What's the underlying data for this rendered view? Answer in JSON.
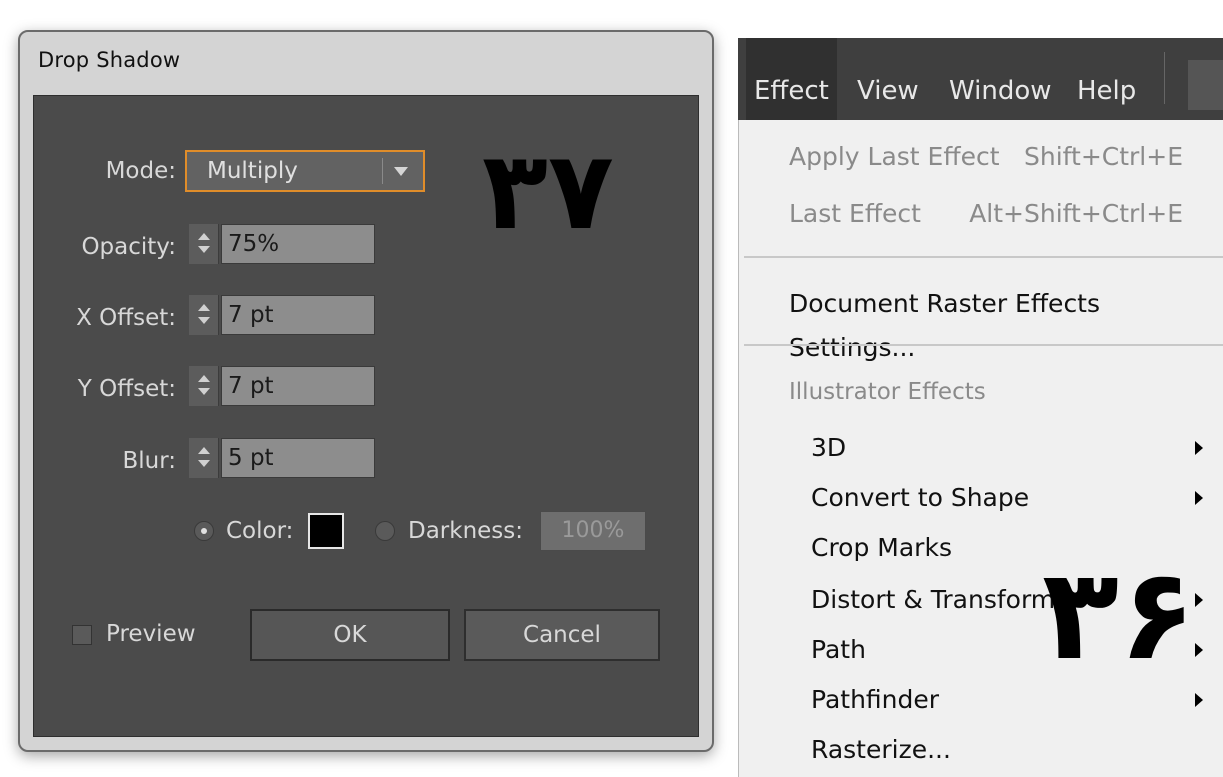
{
  "dialog": {
    "title": "Drop Shadow",
    "mode": {
      "label": "Mode:",
      "value": "Multiply"
    },
    "opacity": {
      "label": "Opacity:",
      "value": "75%"
    },
    "x_offset": {
      "label": "X Offset:",
      "value": "7 pt"
    },
    "y_offset": {
      "label": "Y Offset:",
      "value": "7 pt"
    },
    "blur": {
      "label": "Blur:",
      "value": "5 pt"
    },
    "color_option": {
      "label": "Color:",
      "selected": true,
      "swatch_color": "#000000"
    },
    "darkness_option": {
      "label": "Darkness:",
      "value": "100%",
      "selected": false
    },
    "preview": {
      "label": "Preview",
      "checked": false
    },
    "ok_label": "OK",
    "cancel_label": "Cancel",
    "annotation": "۳۷"
  },
  "menubar": {
    "items": [
      "Effect",
      "View",
      "Window",
      "Help"
    ],
    "active": "Effect"
  },
  "effect_menu": {
    "apply_last": {
      "label": "Apply Last Effect",
      "shortcut": "Shift+Ctrl+E"
    },
    "last_effect": {
      "label": "Last Effect",
      "shortcut": "Alt+Shift+Ctrl+E"
    },
    "document_raster": {
      "label": "Document Raster Effects Settings..."
    },
    "section_header": "Illustrator Effects",
    "items": [
      {
        "label": "3D",
        "submenu": true
      },
      {
        "label": "Convert to Shape",
        "submenu": true
      },
      {
        "label": "Crop Marks",
        "submenu": false
      },
      {
        "label": "Distort & Transform",
        "submenu": true
      },
      {
        "label": "Path",
        "submenu": true
      },
      {
        "label": "Pathfinder",
        "submenu": true
      },
      {
        "label": "Rasterize...",
        "submenu": false
      }
    ],
    "annotation": "۳۶"
  },
  "colors": {
    "dialog_bg": "#4b4b4b",
    "focus_accent": "#e08d2a",
    "menu_bg": "#f0f0f0",
    "menubar_bg": "#3f3f3f"
  }
}
